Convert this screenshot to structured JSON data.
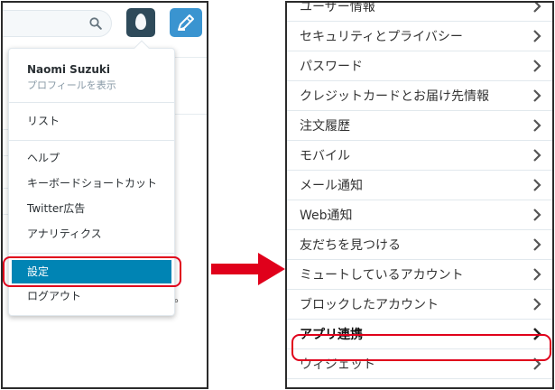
{
  "colors": {
    "avatar_bg": "#2e4a5a",
    "tweet_btn_bg": "#3a94d0",
    "active_item_bg": "#0084b4",
    "highlight": "#e0001b",
    "arrow": "#e0001b"
  },
  "left": {
    "icons": {
      "search": "search-icon",
      "avatar": "egg-avatar-icon",
      "compose": "compose-tweet-icon"
    },
    "dropdown": {
      "user_name": "Naomi Suzuki",
      "profile_link": "プロフィールを表示",
      "items": [
        {
          "label": "リスト"
        },
        {
          "label": "ヘルプ"
        },
        {
          "label": "キーボードショートカット"
        },
        {
          "label": "Twitter広告"
        },
        {
          "label": "アナリティクス"
        },
        {
          "label": "設定",
          "active": true
        },
        {
          "label": "ログアウト"
        }
      ]
    },
    "bg_suffix": "。"
  },
  "right": {
    "settings": [
      {
        "label": "ユーザー情報"
      },
      {
        "label": "セキュリティとプライバシー"
      },
      {
        "label": "パスワード"
      },
      {
        "label": "クレジットカードとお届け先情報"
      },
      {
        "label": "注文履歴"
      },
      {
        "label": "モバイル"
      },
      {
        "label": "メール通知"
      },
      {
        "label": "Web通知"
      },
      {
        "label": "友だちを見つける"
      },
      {
        "label": "ミュートしているアカウント"
      },
      {
        "label": "ブロックしたアカウント"
      },
      {
        "label": "アプリ連携",
        "highlighted": true
      },
      {
        "label": "ウィジェット"
      }
    ]
  }
}
